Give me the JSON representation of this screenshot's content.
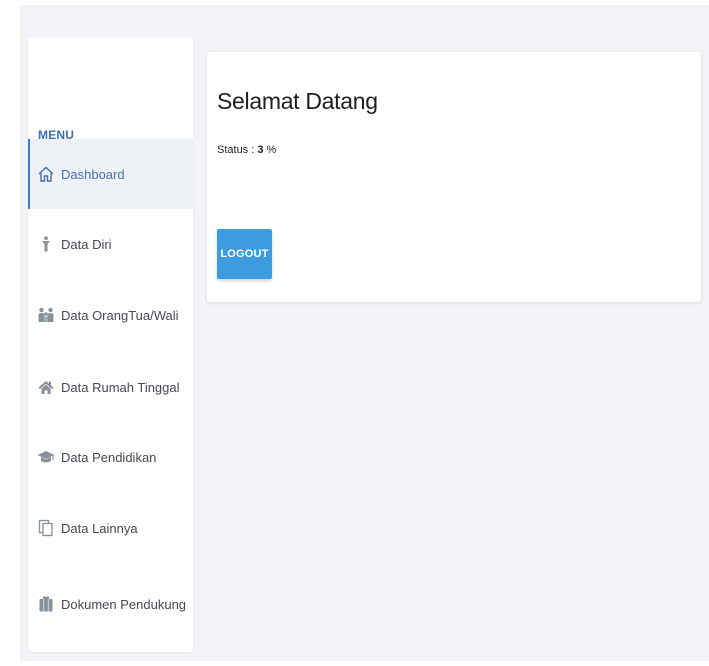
{
  "sidebar": {
    "heading": "MENU",
    "items": [
      {
        "label": "Dashboard",
        "icon": "home-icon",
        "active": true
      },
      {
        "label": "Data Diri",
        "icon": "person-icon"
      },
      {
        "label": "Data OrangTua/Wali",
        "icon": "family-icon"
      },
      {
        "label": "Data Rumah Tinggal",
        "icon": "house-icon"
      },
      {
        "label": "Data Pendidikan",
        "icon": "graduation-cap-icon"
      },
      {
        "label": "Data Lainnya",
        "icon": "documents-icon"
      },
      {
        "label": "Dokumen Pendukung",
        "icon": "folder-icon"
      }
    ]
  },
  "main": {
    "title": "Selamat Datang",
    "status_label": "Status : ",
    "status_value": "3",
    "status_unit": " %",
    "logout_label": "LOGOUT"
  },
  "colors": {
    "accent": "#3b7ddd",
    "button": "#3d9be0",
    "icon": "#8a9099"
  }
}
